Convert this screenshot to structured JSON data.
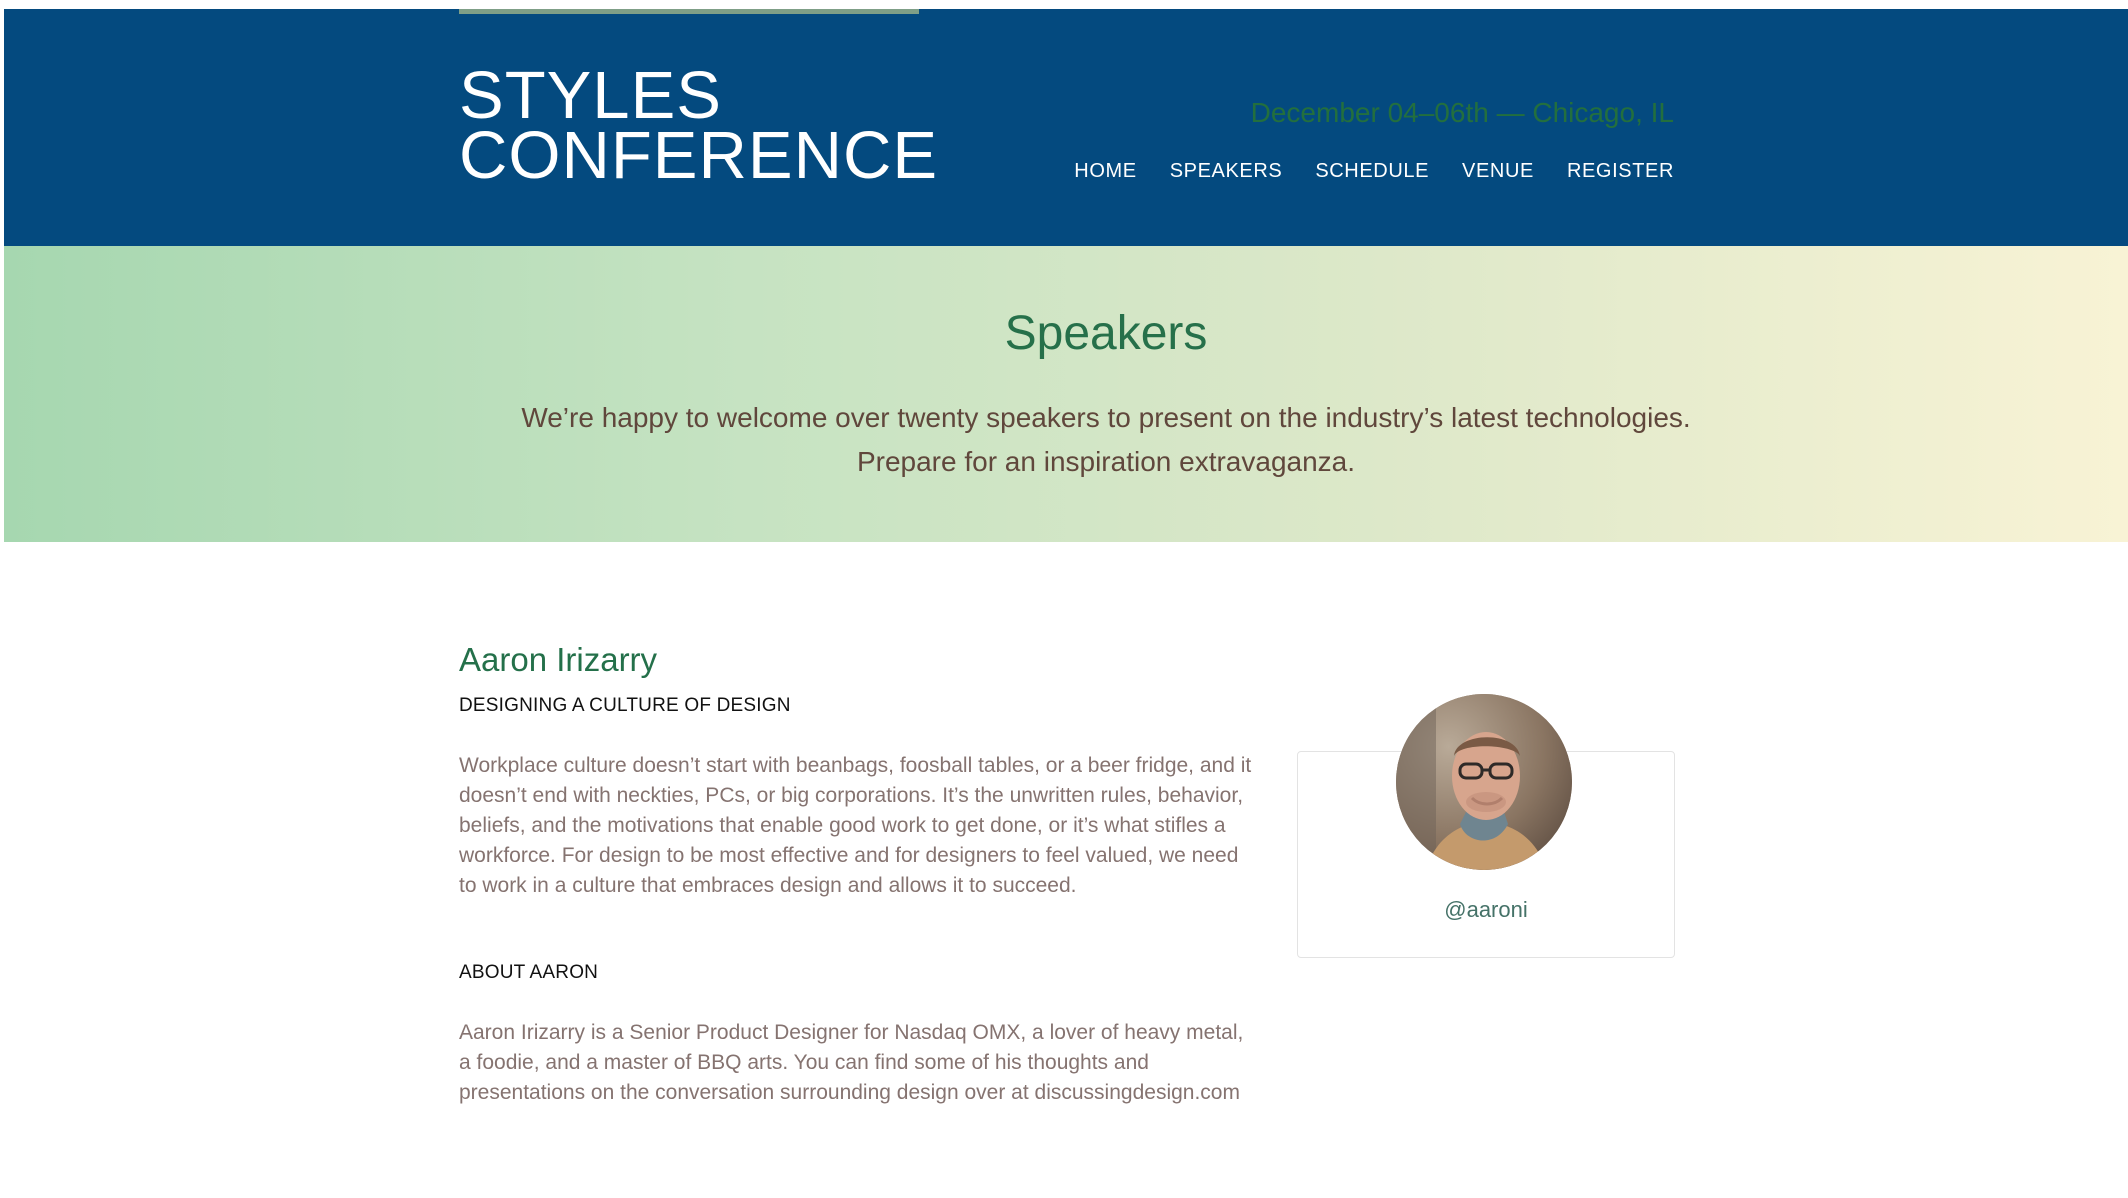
{
  "header": {
    "logo_line1": "STYLES",
    "logo_line2": "CONFERENCE",
    "tagline": "December 04–06th — Chicago, IL",
    "nav": [
      "HOME",
      "SPEAKERS",
      "SCHEDULE",
      "VENUE",
      "REGISTER"
    ]
  },
  "hero": {
    "title": "Speakers",
    "line1": "We’re happy to welcome over twenty speakers to present on the industry’s latest technologies.",
    "line2": "Prepare for an inspiration extravaganza."
  },
  "speaker": {
    "name": "Aaron Irizarry",
    "talk_title": "DESIGNING A CULTURE OF DESIGN",
    "talk_description": "Workplace culture doesn’t start with beanbags, foosball tables, or a beer fridge, and it doesn’t end with neckties, PCs, or big corporations. It’s the unwritten rules, behavior, beliefs, and the motivations that enable good work to get done, or it’s what stifles a workforce. For design to be most effective and for designers to feel valued, we need to work in a culture that embraces design and allows it to succeed.",
    "about_title": "ABOUT AARON",
    "about_description": "Aaron Irizarry is a Senior Product Designer for Nasdaq OMX, a lover of heavy metal, a foodie, and a master of BBQ arts. You can find some of his thoughts and presentations on the conversation surrounding design over at discussingdesign.com",
    "handle": "@aaroni"
  },
  "colors": {
    "header_bg": "#044a7f",
    "accent_green": "#26704a",
    "body_text": "#857370"
  }
}
